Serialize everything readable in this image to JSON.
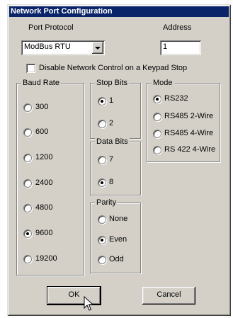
{
  "window": {
    "title": "Network Port Configuration"
  },
  "port_protocol": {
    "label": "Port Protocol",
    "value": "ModBus RTU"
  },
  "address": {
    "label": "Address",
    "value": "1"
  },
  "disable_keypad": {
    "label": "Disable Network Control on a Keypad Stop",
    "checked": false
  },
  "baud_rate": {
    "title": "Baud Rate",
    "options": [
      "300",
      "600",
      "1200",
      "2400",
      "4800",
      "9600",
      "19200"
    ],
    "selected": "9600"
  },
  "stop_bits": {
    "title": "Stop Bits",
    "options": [
      "1",
      "2"
    ],
    "selected": "1"
  },
  "data_bits": {
    "title": "Data Bits",
    "options": [
      "7",
      "8"
    ],
    "selected": "8"
  },
  "parity": {
    "title": "Parity",
    "options": [
      "None",
      "Even",
      "Odd"
    ],
    "selected": "Even"
  },
  "mode": {
    "title": "Mode",
    "options": [
      "RS232",
      "RS485 2-Wire",
      "RS485 4-Wire",
      "RS 422 4-Wire"
    ],
    "selected": "RS232"
  },
  "buttons": {
    "ok": "OK",
    "cancel": "Cancel"
  }
}
